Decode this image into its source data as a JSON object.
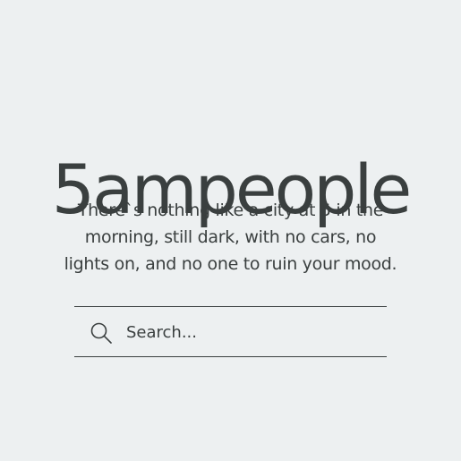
{
  "header": {
    "title": "5ampeople"
  },
  "tagline": {
    "lines": [
      "There`s nothing like a city at 5 in the",
      "morning, still dark, with no cars, no",
      "lights on, and no one to ruin your mood."
    ]
  },
  "search": {
    "placeholder": "Search...",
    "value": "",
    "icon": "search-icon"
  },
  "colors": {
    "background": "#edf0f1",
    "text": "#3a3f3f"
  }
}
